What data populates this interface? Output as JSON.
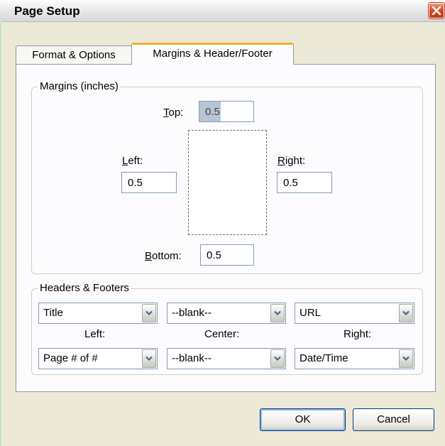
{
  "window": {
    "title": "Page Setup"
  },
  "tabs": [
    {
      "label": "Format & Options",
      "active": false
    },
    {
      "label": "Margins & Header/Footer",
      "active": true
    }
  ],
  "margins": {
    "legend": "Margins (inches)",
    "top_label_u": "T",
    "top_label_rest": "op:",
    "top_value": "0.5",
    "left_label_u": "L",
    "left_label_rest": "eft:",
    "left_value": "0.5",
    "right_label_u": "R",
    "right_label_rest": "ight:",
    "right_value": "0.5",
    "bottom_label_u": "B",
    "bottom_label_rest": "ottom:",
    "bottom_value": "0.5"
  },
  "headers_footers": {
    "legend": "Headers & Footers",
    "header_left": "Title",
    "header_center": "--blank--",
    "header_right": "URL",
    "left_label": "Left:",
    "center_label": "Center:",
    "right_label": "Right:",
    "footer_left": "Page # of #",
    "footer_center": "--blank--",
    "footer_right": "Date/Time"
  },
  "buttons": {
    "ok": "OK",
    "cancel": "Cancel"
  },
  "colors": {
    "active_tab_accent": "#f3b032",
    "close_button": "#d5451f"
  },
  "icons": {
    "close": "close-icon",
    "dropdown": "chevron-down-icon"
  }
}
